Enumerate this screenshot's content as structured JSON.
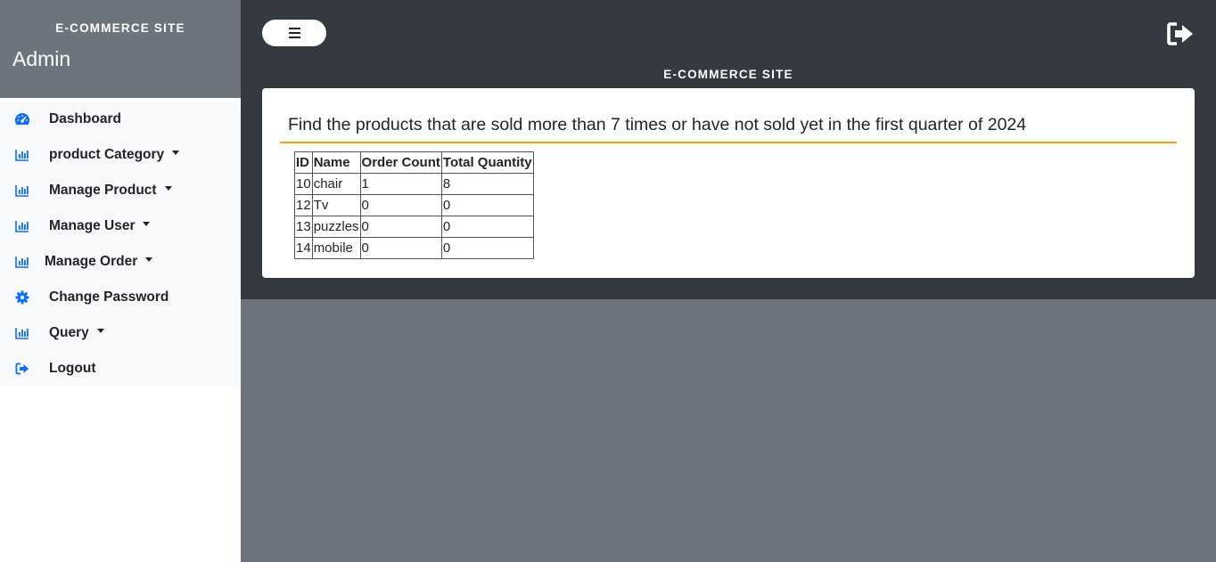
{
  "sidebar": {
    "site_name": "E-COMMERCE SITE",
    "admin_title": "Admin",
    "items": [
      {
        "label": "Dashboard",
        "icon": "tachometer-icon",
        "dropdown": false
      },
      {
        "label": "product Category",
        "icon": "bar-chart-icon",
        "dropdown": true
      },
      {
        "label": "Manage Product",
        "icon": "bar-chart-icon",
        "dropdown": true
      },
      {
        "label": "Manage User",
        "icon": "bar-chart-icon",
        "dropdown": true
      },
      {
        "label": "Manage Order",
        "icon": "bar-chart-icon",
        "dropdown": true
      },
      {
        "label": "Change Password",
        "icon": "gear-icon",
        "dropdown": false
      },
      {
        "label": "Query",
        "icon": "bar-chart-icon",
        "dropdown": true
      },
      {
        "label": "Logout",
        "icon": "sign-out-icon",
        "dropdown": false
      }
    ]
  },
  "header": {
    "title": "E-COMMERCE SITE",
    "toggle_icon": "hamburger-icon",
    "logout_icon": "sign-out-icon"
  },
  "main": {
    "heading": "Find the products that are sold more than 7 times or have not sold yet in the first quarter of 2024",
    "table": {
      "columns": [
        "ID",
        "Name",
        "Order Count",
        "Total Quantity"
      ],
      "rows": [
        [
          "10",
          "chair",
          "1",
          "8"
        ],
        [
          "12",
          "Tv",
          "0",
          "0"
        ],
        [
          "13",
          "puzzles",
          "0",
          "0"
        ],
        [
          "14",
          "mobile",
          "0",
          "0"
        ]
      ]
    }
  },
  "colors": {
    "sidebar_header": "#6c757d",
    "topbar": "#343a40",
    "accent_icon": "#0d6efd",
    "heading_rule": "#f0a30a",
    "page_background": "#6c757d"
  }
}
